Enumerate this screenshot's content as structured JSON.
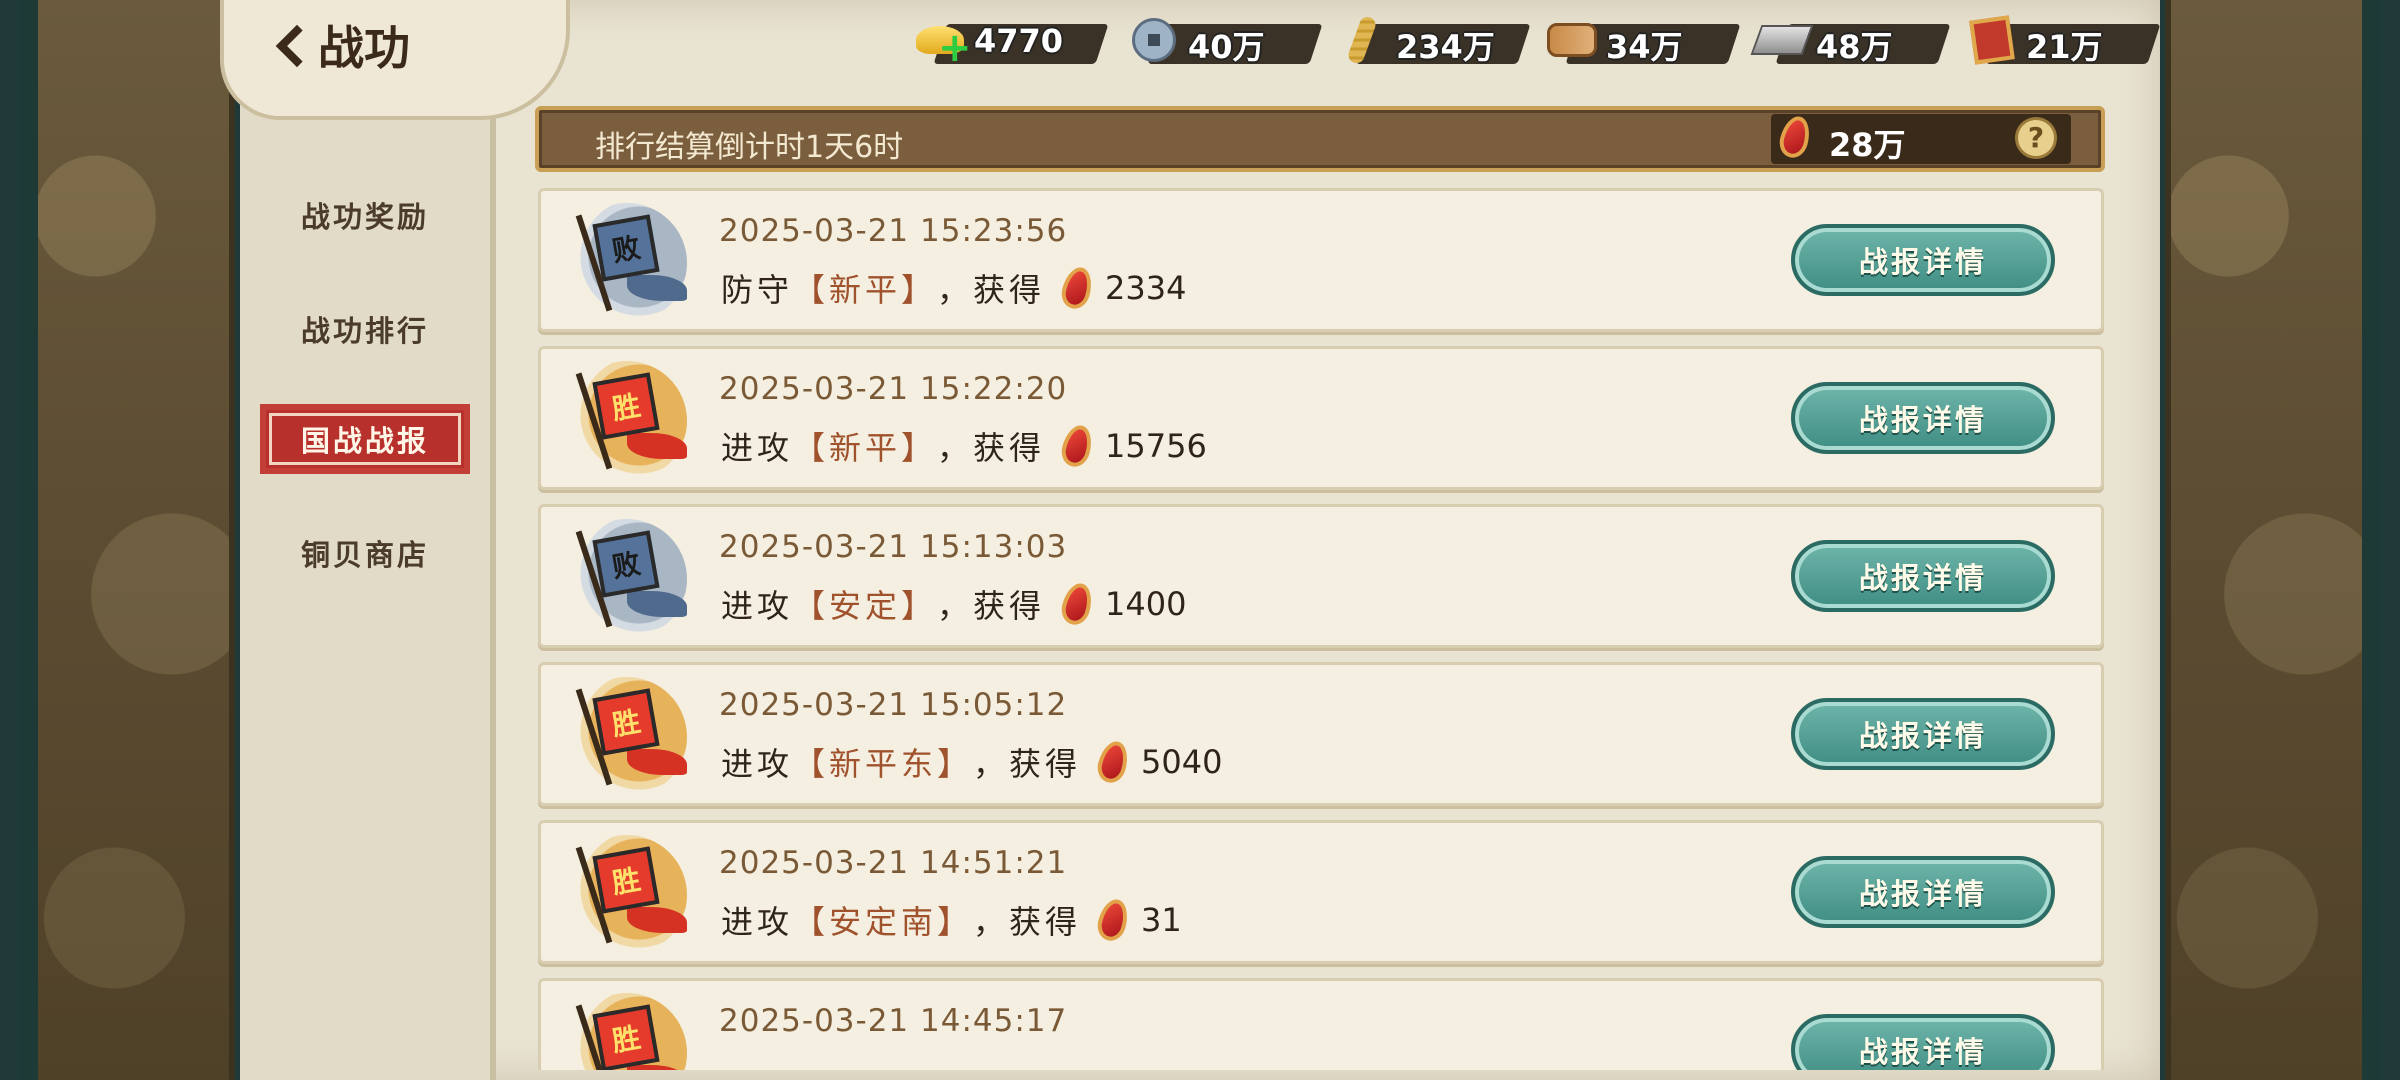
{
  "header": {
    "title": "战功"
  },
  "resources": [
    {
      "icon": "gold-ingot-icon",
      "value": "4770"
    },
    {
      "icon": "copper-coin-icon",
      "value": "40万"
    },
    {
      "icon": "grain-icon",
      "value": "234万"
    },
    {
      "icon": "wood-icon",
      "value": "34万"
    },
    {
      "icon": "iron-icon",
      "value": "48万"
    },
    {
      "icon": "merit-seal-icon",
      "value": "21万"
    }
  ],
  "sidebar": {
    "items": [
      {
        "label": "战功奖励",
        "active": false
      },
      {
        "label": "战功排行",
        "active": false
      },
      {
        "label": "国战战报",
        "active": true
      },
      {
        "label": "铜贝商店",
        "active": false
      }
    ]
  },
  "countdown": {
    "text": "排行结算倒计时1天6时",
    "score": "28万",
    "help": "?"
  },
  "colors": {
    "accent_red": "#b8302b",
    "button_teal": "#4f9f94",
    "place_brown": "#a0522d"
  },
  "battles": [
    {
      "result": "败",
      "time": "2025-03-21  15:23:56",
      "action": "防守",
      "place": "【新平】",
      "gain": "，获得",
      "amount": "2334",
      "button": "战报详情"
    },
    {
      "result": "胜",
      "time": "2025-03-21  15:22:20",
      "action": "进攻",
      "place": "【新平】",
      "gain": "，获得",
      "amount": "15756",
      "button": "战报详情"
    },
    {
      "result": "败",
      "time": "2025-03-21  15:13:03",
      "action": "进攻",
      "place": "【安定】",
      "gain": "，获得",
      "amount": "1400",
      "button": "战报详情"
    },
    {
      "result": "胜",
      "time": "2025-03-21  15:05:12",
      "action": "进攻",
      "place": "【新平东】",
      "gain": "，获得",
      "amount": "5040",
      "button": "战报详情"
    },
    {
      "result": "胜",
      "time": "2025-03-21  14:51:21",
      "action": "进攻",
      "place": "【安定南】",
      "gain": "，获得",
      "amount": "31",
      "button": "战报详情"
    },
    {
      "result": "胜",
      "time": "2025-03-21  14:45:17",
      "action": "",
      "place": "",
      "gain": "",
      "amount": "",
      "button": "战报详情"
    }
  ]
}
